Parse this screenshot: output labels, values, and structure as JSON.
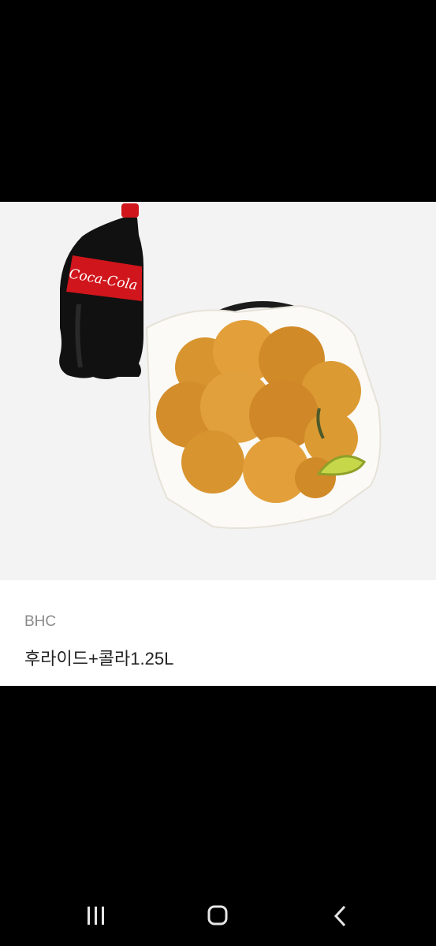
{
  "product": {
    "image": "fried-chicken-and-cola-photo",
    "brand": "BHC",
    "title": "후라이드+콜라1.25L",
    "bottle_label": "Coca-Cola"
  },
  "navigation": {
    "icons": [
      "recent-apps-icon",
      "home-icon",
      "back-icon"
    ]
  },
  "colors": {
    "background_top": "#000000",
    "image_bg": "#f3f3f3",
    "card_bg": "#ffffff",
    "brand_text": "#8a8a8a",
    "title_text": "#222222",
    "cola_red": "#d0161c",
    "chicken": "#d8942e"
  }
}
